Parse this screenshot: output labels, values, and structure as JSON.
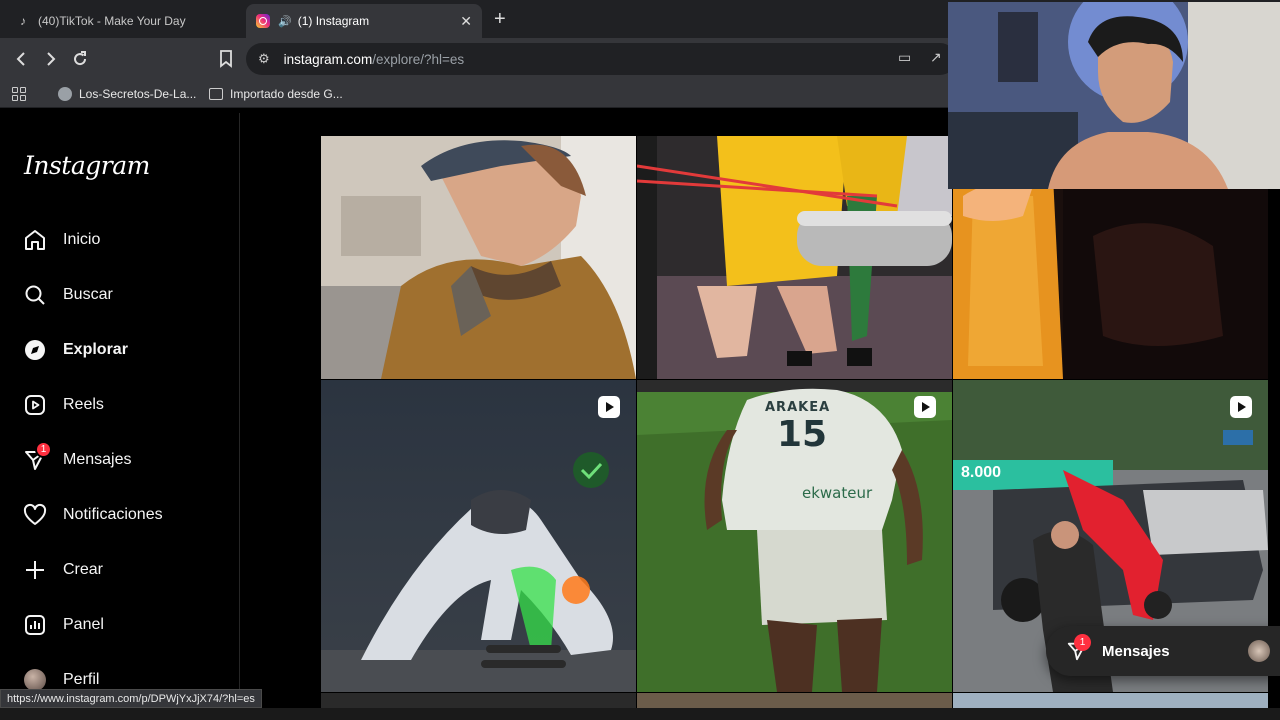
{
  "browser": {
    "tabs": [
      {
        "title": "(40)TikTok - Make Your Day",
        "icon": "tiktok-icon",
        "active": false
      },
      {
        "title": "(1) Instagram",
        "icon": "instagram-icon",
        "active": true
      }
    ],
    "address": {
      "host": "instagram.com",
      "path": "/explore/?hl=es"
    },
    "bookmarks": [
      {
        "label": "Los-Secretos-De-La...",
        "icon": "globe-icon"
      },
      {
        "label": "Importado desde G...",
        "icon": "folder-icon"
      }
    ],
    "status_url": "https://www.instagram.com/p/DPWjYxJjX74/?hl=es"
  },
  "instagram": {
    "logo": "Instagram",
    "nav": [
      {
        "label": "Inicio",
        "icon": "home-icon"
      },
      {
        "label": "Buscar",
        "icon": "search-icon"
      },
      {
        "label": "Explorar",
        "icon": "compass-icon",
        "active": true
      },
      {
        "label": "Reels",
        "icon": "reels-icon"
      },
      {
        "label": "Mensajes",
        "icon": "messenger-icon",
        "badge": "1"
      },
      {
        "label": "Notificaciones",
        "icon": "heart-icon"
      },
      {
        "label": "Crear",
        "icon": "plus-icon"
      },
      {
        "label": "Panel",
        "icon": "dashboard-icon"
      },
      {
        "label": "Perfil",
        "icon": "avatar"
      }
    ],
    "messages_pill": {
      "label": "Mensajes",
      "badge": "1"
    },
    "jersey_text": {
      "sponsor": "ARAKEA",
      "number": "15",
      "brand": "ekwateur"
    },
    "banner_text": "8.000",
    "colors": {
      "accent": "#0095f6",
      "badge": "#ff3040",
      "background": "#000000"
    }
  }
}
